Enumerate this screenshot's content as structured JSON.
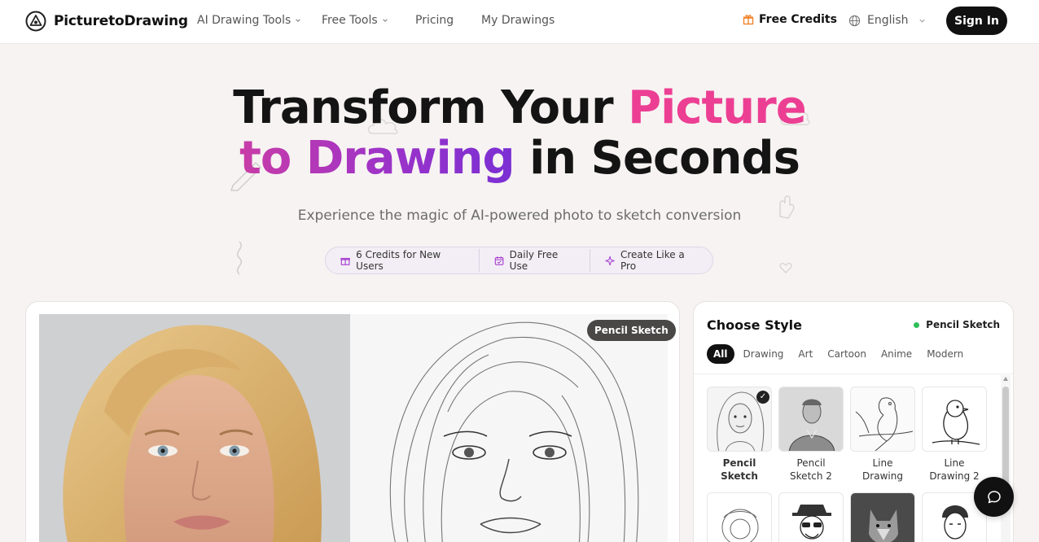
{
  "header": {
    "logo_text": "PicturetoDrawing",
    "nav": [
      {
        "label": "AI Drawing Tools",
        "dropdown": true
      },
      {
        "label": "Free Tools",
        "dropdown": true
      },
      {
        "label": "Pricing",
        "dropdown": false
      },
      {
        "label": "My Drawings",
        "dropdown": false
      }
    ],
    "credits_label": "Free Credits",
    "language": "English",
    "signin_label": "Sign In"
  },
  "hero": {
    "title_part1": "Transform Your ",
    "title_highlight1": "Picture",
    "title_highlight2": "to Drawing",
    "title_part2": " in Seconds",
    "subtitle": "Experience the magic of AI-powered photo to sketch conversion",
    "badges": [
      {
        "icon": "gift-icon",
        "label": "6 Credits for New Users"
      },
      {
        "icon": "calendar-icon",
        "label": "Daily Free Use"
      },
      {
        "icon": "sparkle-icon",
        "label": "Create Like a Pro"
      }
    ]
  },
  "compare": {
    "result_tag": "Pencil Sketch"
  },
  "style_panel": {
    "title": "Choose Style",
    "selected": "Pencil Sketch",
    "tabs": [
      "All",
      "Drawing",
      "Art",
      "Cartoon",
      "Anime",
      "Modern"
    ],
    "active_tab": "All",
    "styles": [
      {
        "line1": "Pencil",
        "line2": "Sketch",
        "selected": true
      },
      {
        "line1": "Pencil",
        "line2": "Sketch 2",
        "selected": false
      },
      {
        "line1": "Line",
        "line2": "Drawing",
        "selected": false
      },
      {
        "line1": "Line",
        "line2": "Drawing 2",
        "selected": false
      }
    ]
  },
  "colors": {
    "accent_pink": "#ec3f93",
    "accent_purple": "#9b33c9",
    "dark": "#111111",
    "online_dot": "#2fbf58"
  }
}
